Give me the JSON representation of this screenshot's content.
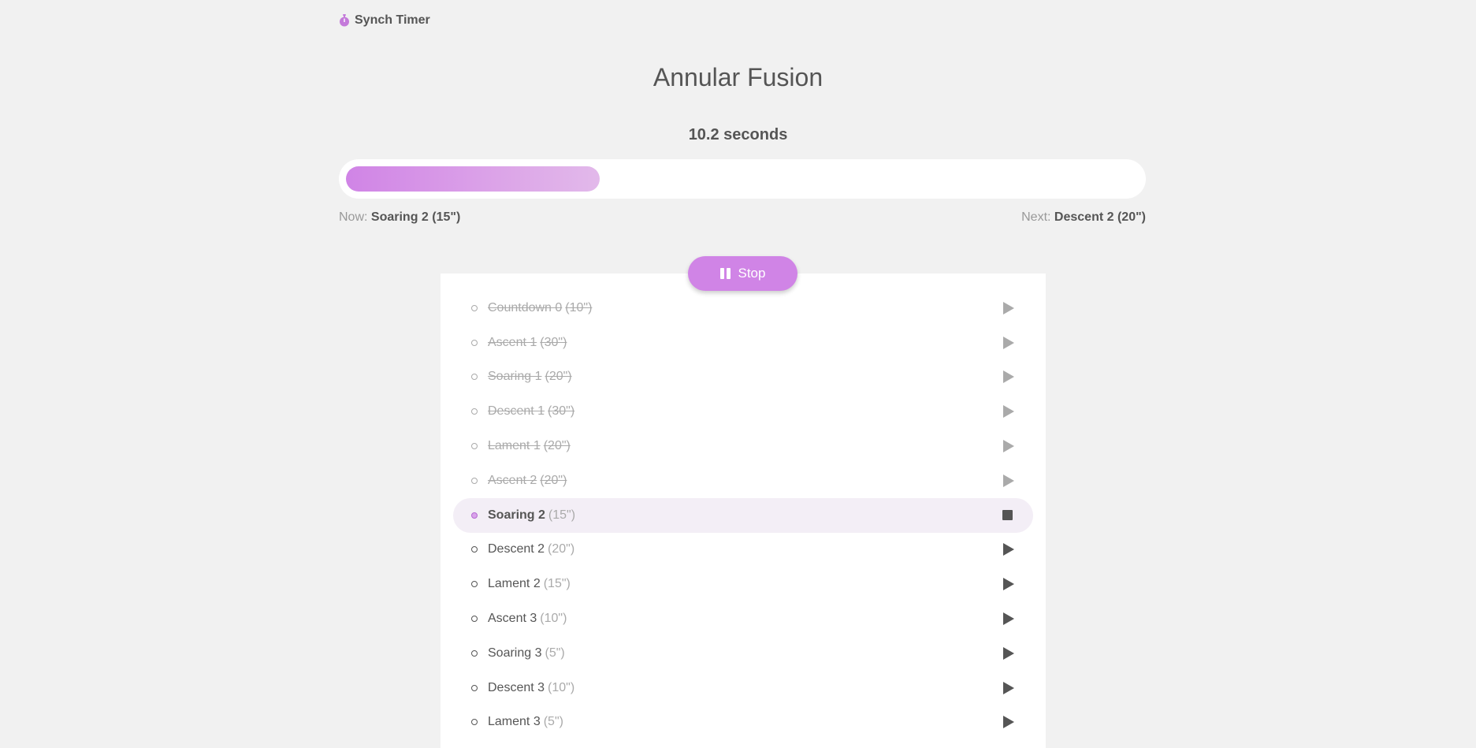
{
  "brand": {
    "name": "Synch Timer",
    "icon": "stopwatch-icon"
  },
  "title": "Annular Fusion",
  "timer": {
    "seconds_label": "10.2 seconds",
    "progress_fraction": 0.32
  },
  "now": {
    "prefix": "Now:",
    "value": "Soaring 2  (15\")"
  },
  "next": {
    "prefix": "Next:",
    "value": "Descent 2  (20\")"
  },
  "stop_button": {
    "label": "Stop",
    "icon": "pause-icon"
  },
  "colors": {
    "accent": "#d084e6",
    "background": "#f1f1f1",
    "active_row": "#f3eef6"
  },
  "steps": [
    {
      "name": "Countdown 0",
      "duration": "(10\")",
      "state": "done"
    },
    {
      "name": "Ascent 1",
      "duration": "(30\")",
      "state": "done"
    },
    {
      "name": "Soaring 1",
      "duration": "(20\")",
      "state": "done"
    },
    {
      "name": "Descent 1",
      "duration": "(30\")",
      "state": "done"
    },
    {
      "name": "Lament 1",
      "duration": "(20\")",
      "state": "done"
    },
    {
      "name": "Ascent 2",
      "duration": "(20\")",
      "state": "done"
    },
    {
      "name": "Soaring 2",
      "duration": "(15\")",
      "state": "active"
    },
    {
      "name": "Descent 2",
      "duration": "(20\")",
      "state": "pending"
    },
    {
      "name": "Lament 2",
      "duration": "(15\")",
      "state": "pending"
    },
    {
      "name": "Ascent 3",
      "duration": "(10\")",
      "state": "pending"
    },
    {
      "name": "Soaring 3",
      "duration": "(5\")",
      "state": "pending"
    },
    {
      "name": "Descent 3",
      "duration": "(10\")",
      "state": "pending"
    },
    {
      "name": "Lament 3",
      "duration": "(5\")",
      "state": "pending"
    }
  ]
}
